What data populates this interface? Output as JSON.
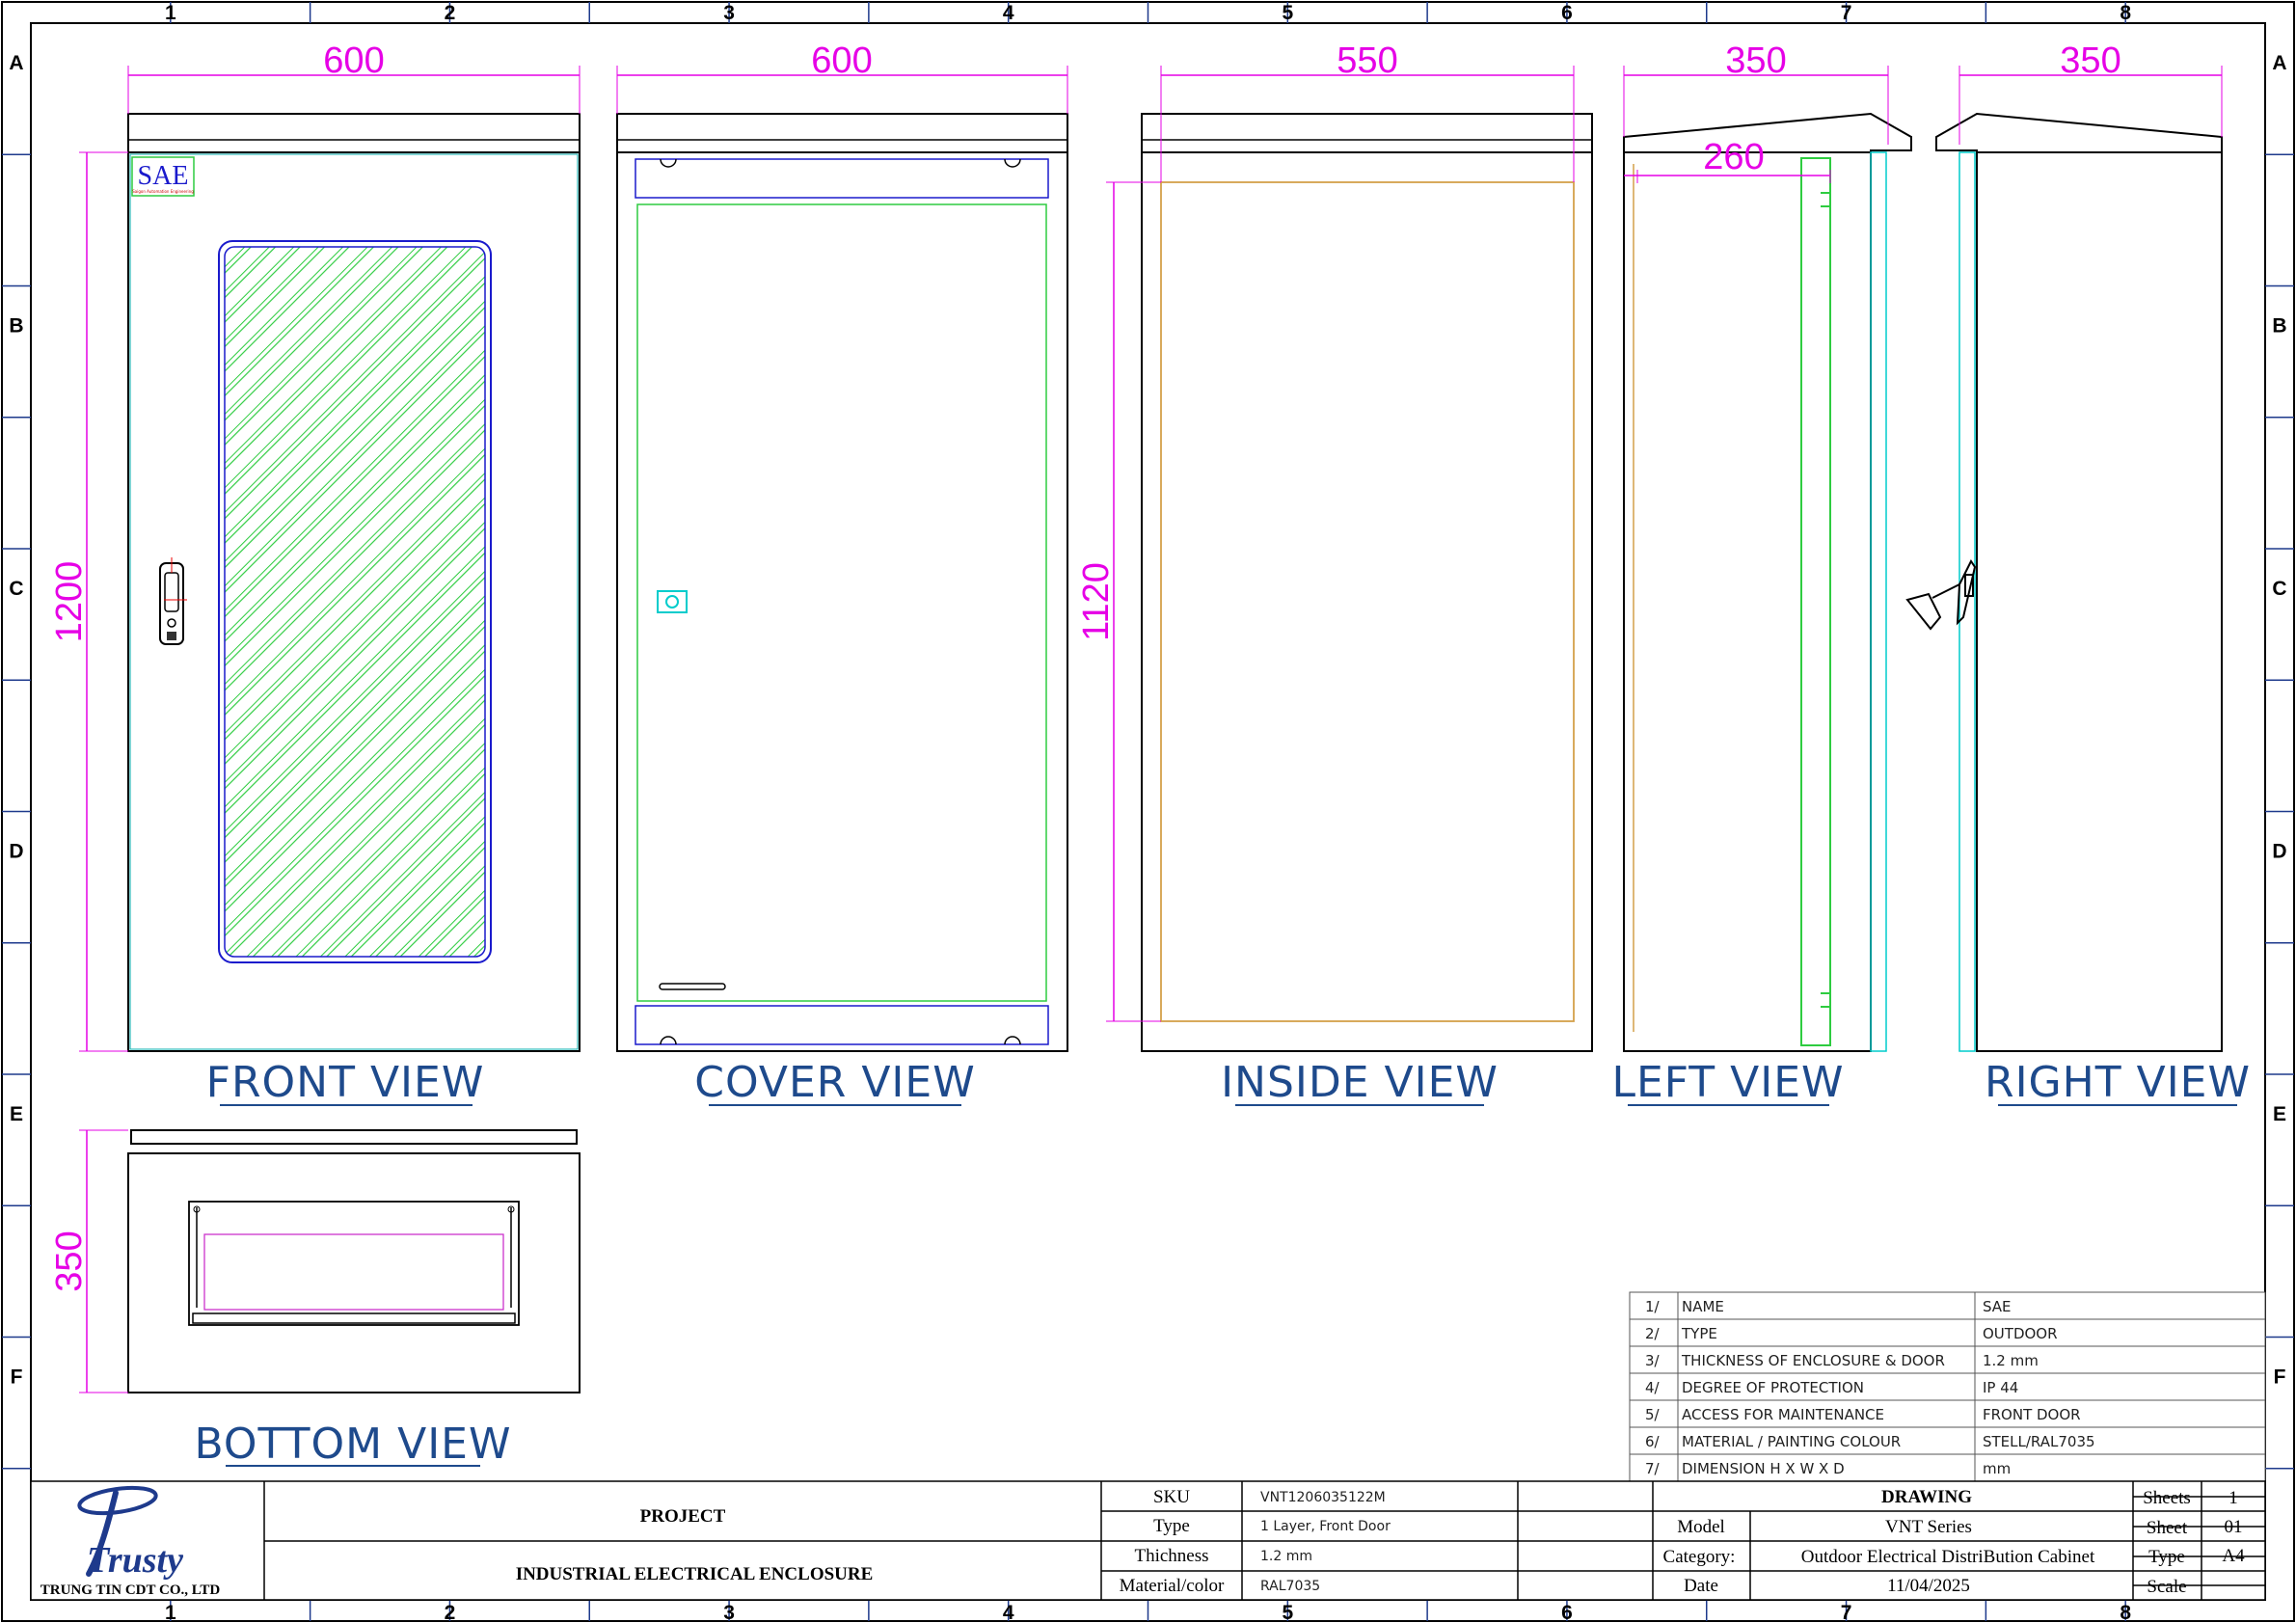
{
  "zones": {
    "cols": [
      "1",
      "2",
      "3",
      "4",
      "5",
      "6",
      "7",
      "8"
    ],
    "rows": [
      "A",
      "B",
      "C",
      "D",
      "E",
      "F"
    ]
  },
  "dimensions": {
    "front_width": "600",
    "front_height": "1200",
    "cover_width": "600",
    "inside_width": "550",
    "inside_height": "1120",
    "left_depth": "350",
    "left_inner_depth": "260",
    "right_depth": "350",
    "bottom_depth": "350"
  },
  "views": {
    "front": "FRONT VIEW",
    "cover": "COVER VIEW",
    "inside": "INSIDE VIEW",
    "left": "LEFT VIEW",
    "right": "RIGHT VIEW",
    "bottom": "BOTTOM VIEW"
  },
  "logo_plate": {
    "text": "SAE",
    "subtext": "Saigon Automation Engineering"
  },
  "spec_table": [
    {
      "no": "1/",
      "item": "NAME",
      "value": "SAE"
    },
    {
      "no": "2/",
      "item": "TYPE",
      "value": "OUTDOOR"
    },
    {
      "no": "3/",
      "item": "THICKNESS OF ENCLOSURE & DOOR",
      "value": "1.2 mm"
    },
    {
      "no": "4/",
      "item": "DEGREE OF PROTECTION",
      "value": "IP 44"
    },
    {
      "no": "5/",
      "item": "ACCESS FOR MAINTENANCE",
      "value": "FRONT DOOR"
    },
    {
      "no": "6/",
      "item": "MATERIAL / PAINTING COLOUR",
      "value": "STELL/RAL7035"
    },
    {
      "no": "7/",
      "item": "DIMENSION  H X W X D",
      "value": "mm"
    }
  ],
  "title_block": {
    "company_logo": "Trusty",
    "company_name": "TRUNG TIN CDT CO., LTD",
    "project_label": "PROJECT",
    "project_name": "INDUSTRIAL ELECTRICAL ENCLOSURE",
    "sku_label": "SKU",
    "sku": "VNT1206035122M",
    "type_label": "Type",
    "type": "1 Layer, Front Door",
    "thickness_label": "Thichness",
    "thickness": "1.2 mm",
    "material_label": "Material/color",
    "material": "RAL7035",
    "drawing_label": "DRAWING",
    "model_label": "Model",
    "model": "VNT Series",
    "category_label": "Category:",
    "category": "Outdoor Electrical DistriBution Cabinet",
    "date_label": "Date",
    "date": "11/04/2025",
    "sheets_label": "Sheets",
    "sheets": "1",
    "sheet_label": "Sheet",
    "sheet": "01",
    "paper_label": "Type",
    "paper": "A4",
    "scale_label": "Scale",
    "scale": ""
  },
  "colors": {
    "dimension": "#e600e6",
    "view_label": "#1e4a8c",
    "hatch": "#2ecc40",
    "door_outline": "#1a1acc",
    "inside_panel": "#d4a04a",
    "hinge_cyan": "#00cccc"
  }
}
